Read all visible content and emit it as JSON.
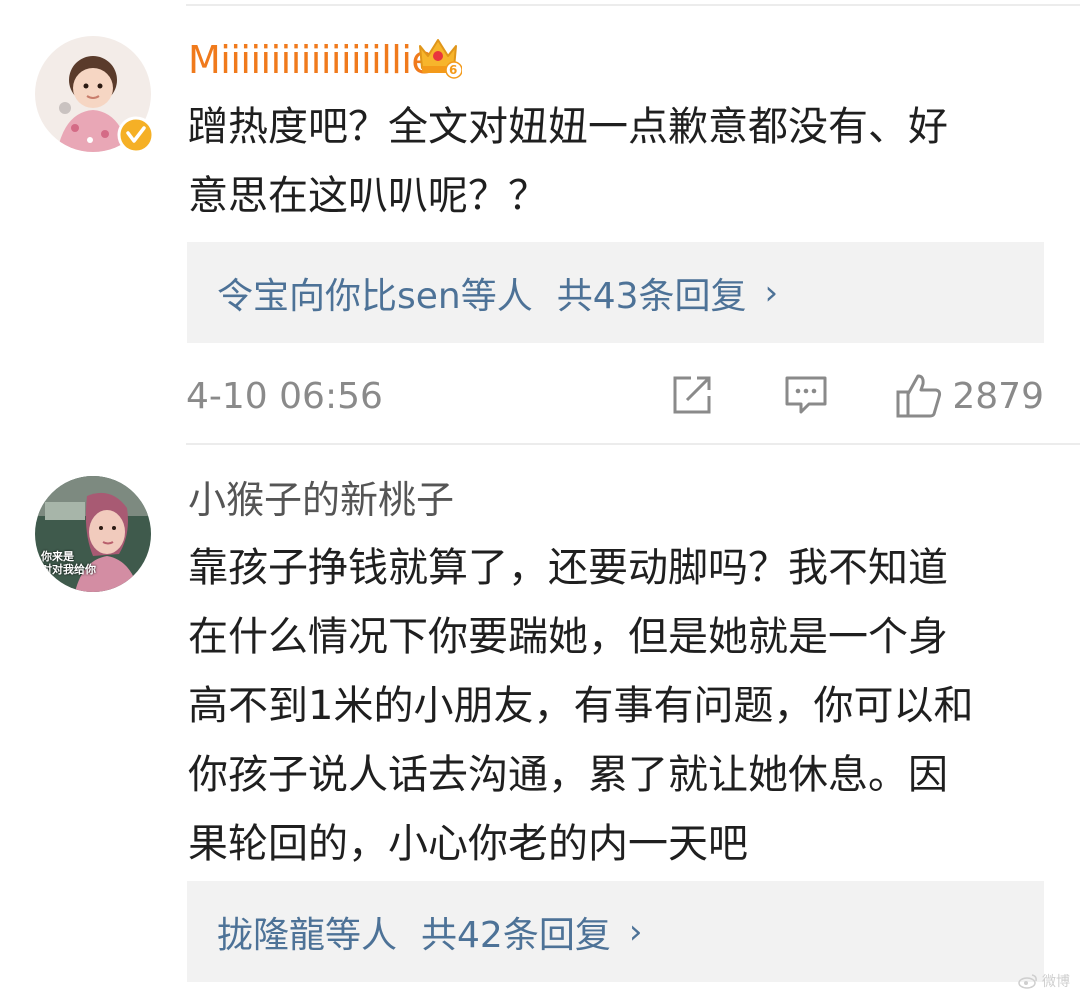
{
  "comments": [
    {
      "username": "Miiiiiiiiiiiiiiiillie",
      "username_color": "#f07a1c",
      "badge_level": "6",
      "verified": true,
      "content": "蹭热度吧？全文对妞妞一点歉意都没有、好\n意思在这叭叭呢？？",
      "replies_users": "令宝向你比sen等人",
      "replies_count": "共43条回复",
      "timestamp": "4-10 06:56",
      "likes": "2879"
    },
    {
      "username": "小猴子的新桃子",
      "username_color": "#555555",
      "avatar_caption": "你来是\n对对我给你",
      "content": "靠孩子挣钱就算了，还要动脚吗？我不知道\n在什么情况下你要踹她，但是她就是一个身\n高不到1米的小朋友，有事有问题，你可以和\n你孩子说人话去沟通，累了就让她休息。因\n果轮回的，小心你老的内一天吧",
      "replies_users": "拢隆龍等人",
      "replies_count": "共42条回复"
    }
  ],
  "icons": {
    "share": "share-icon",
    "comment": "comment-icon",
    "like": "thumbs-up-icon",
    "chevron": "chevron-right-icon",
    "crown": "crown-badge-icon",
    "verified": "verified-badge-icon"
  },
  "chevron_glyph": "›",
  "watermark_text": "微博"
}
